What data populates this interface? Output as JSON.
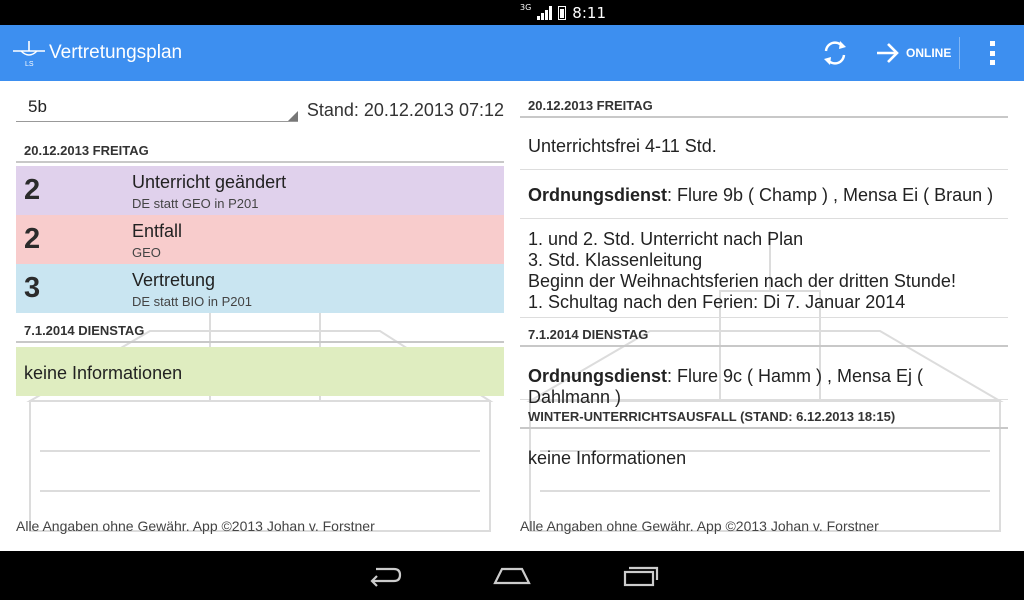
{
  "status_bar": {
    "network": "3G",
    "time": "8:11"
  },
  "action_bar": {
    "title": "Vertretungsplan",
    "online_label": "ONLINE"
  },
  "left": {
    "class_select": "5b",
    "stand": "Stand: 20.12.2013 07:12",
    "sections": [
      {
        "header": "20.12.2013 FREITAG",
        "rows": [
          {
            "hour": "2",
            "title": "Unterricht geändert",
            "detail": "DE statt GEO in P201",
            "color": "#e0d1ec"
          },
          {
            "hour": "2",
            "title": "Entfall",
            "detail": "GEO",
            "color": "#f8cccc"
          },
          {
            "hour": "3",
            "title": "Vertretung",
            "detail": "DE statt BIO in P201",
            "color": "#c9e5f1"
          }
        ]
      },
      {
        "header": "7.1.2014 DIENSTAG",
        "info": "keine Informationen",
        "color": "#dfedc0"
      }
    ],
    "footer": "Alle Angaben ohne Gewähr. App ©2013 Johan v. Forstner"
  },
  "right": {
    "sections": [
      {
        "header": "20.12.2013 FREITAG",
        "items": [
          {
            "text": "Unterrichtsfrei  4-11 Std."
          },
          {
            "bold": "Ordnungsdienst",
            "text": ": Flure 9b ( Champ ) , Mensa Ei ( Braun )"
          },
          {
            "lines": [
              "1. und 2. Std. Unterricht nach Plan",
              "3. Std. Klassenleitung",
              "Beginn der Weihnachtsferien nach der dritten Stunde!",
              "1. Schultag nach den Ferien: Di 7. Januar 2014"
            ]
          }
        ]
      },
      {
        "header": "7.1.2014 DIENSTAG",
        "items": [
          {
            "bold": "Ordnungsdienst",
            "text": ": Flure 9c ( Hamm ) , Mensa Ej ( Dahlmann )"
          }
        ]
      },
      {
        "header": "WINTER-UNTERRICHTSAUSFALL (STAND: 6.12.2013 18:15)",
        "items": [
          {
            "text": "keine Informationen"
          }
        ]
      }
    ],
    "footer": "Alle Angaben ohne Gewähr. App ©2013 Johan v. Forstner"
  },
  "colors": {
    "action_bar": "#3d8ff0",
    "status_bar": "#000000",
    "nav_bar": "#000000"
  },
  "icons": [
    "logo-icon",
    "refresh-icon",
    "arrow-right-icon",
    "overflow-menu-icon",
    "back-icon",
    "home-icon",
    "recent-apps-icon"
  ]
}
